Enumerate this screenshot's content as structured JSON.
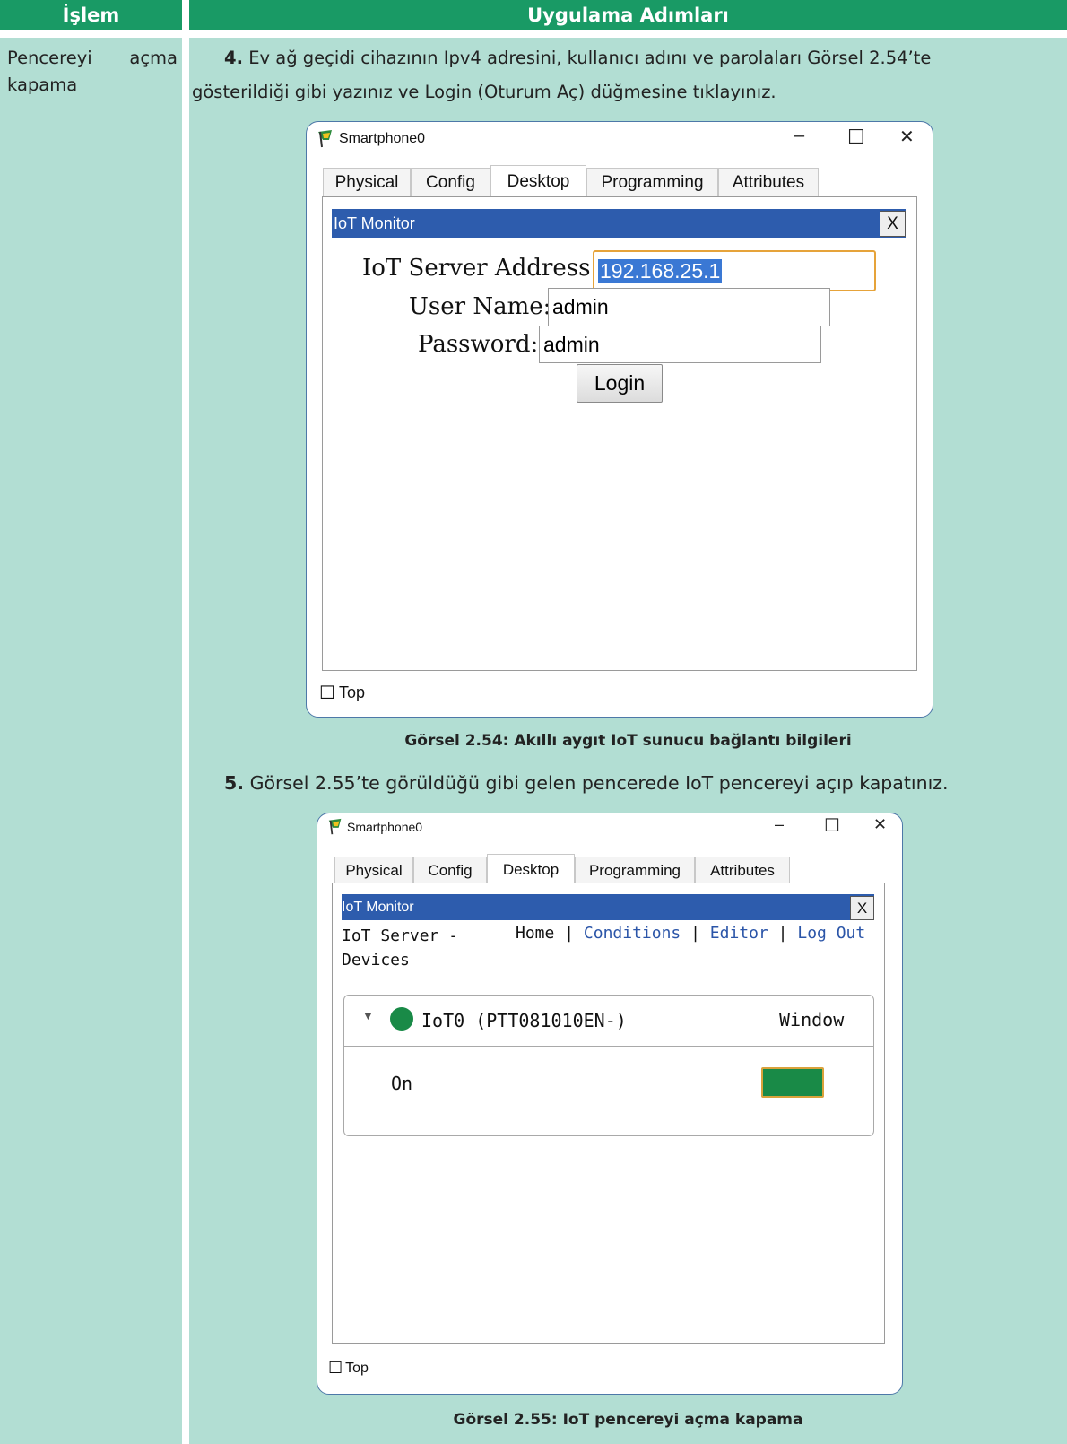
{
  "table": {
    "header_left": "İşlem",
    "header_right": "Uygulama Adımları",
    "left_cell_line1": "Pencereyi açma",
    "left_cell_line2": "kapama"
  },
  "step4": {
    "num": "4.",
    "line1": "Ev ağ geçidi cihazının Ipv4 adresini, kullanıcı adını ve parolaları Görsel 2.54’te",
    "line2": "gösterildiği gibi yazınız ve Login (Oturum Aç) düğmesine tıklayınız."
  },
  "window1": {
    "title": "Smartphone0",
    "minimize": "–",
    "maximize": "☐",
    "close": "✕",
    "tabs": [
      "Physical",
      "Config",
      "Desktop",
      "Programming",
      "Attributes"
    ],
    "active_tab": "Desktop",
    "panel_title": "IoT Monitor",
    "panel_close": "X",
    "server_label": "IoT Server Address:",
    "server_value": "192.168.25.1",
    "user_label": "User Name:",
    "user_value": "admin",
    "pass_label": "Password:",
    "pass_value": "admin",
    "login": "Login",
    "top_label": "Top"
  },
  "caption1": "Görsel 2.54: Akıllı aygıt IoT sunucu bağlantı bilgileri",
  "step5": {
    "num": "5.",
    "text": "Görsel 2.55’te görüldüğü gibi gelen pencerede IoT pencereyi açıp kapatınız."
  },
  "window2": {
    "title": "Smartphone0",
    "minimize": "–",
    "maximize": "☐",
    "close": "✕",
    "tabs": [
      "Physical",
      "Config",
      "Desktop",
      "Programming",
      "Attributes"
    ],
    "active_tab": "Desktop",
    "panel_title": "IoT Monitor",
    "panel_close": "X",
    "server_line1": "IoT Server -",
    "server_line2": "Devices",
    "nav_home": "Home",
    "nav_sep": "|",
    "nav_conditions": "Conditions",
    "nav_editor": "Editor",
    "nav_logout": "Log Out",
    "device_name": "IoT0 (PTT081010EN-)",
    "device_type": "Window",
    "state_label": "On",
    "status_color": "#198a47",
    "link_color": "#2b55a8",
    "top_label": "Top"
  },
  "caption2": "Görsel 2.55: IoT pencereyi açma kapama"
}
